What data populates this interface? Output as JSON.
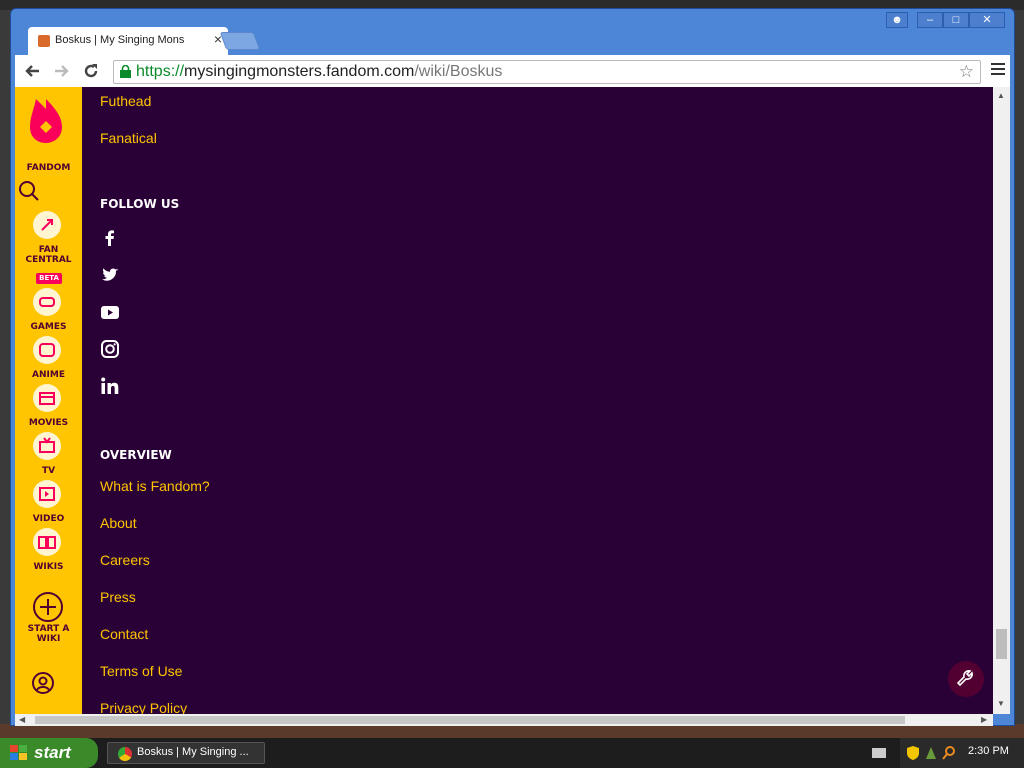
{
  "browser": {
    "tab_title": "Boskus | My Singing Mons",
    "url_scheme": "https://",
    "url_host": "mysingingmonsters.fandom.com",
    "url_path": "/wiki/Boskus",
    "window_buttons": [
      "☻",
      "–",
      "□",
      "✕"
    ]
  },
  "rail": {
    "logo_label": "FANDOM",
    "items": [
      {
        "label1": "FAN",
        "label2": "CENTRAL",
        "badge": "BETA"
      },
      {
        "label1": "GAMES"
      },
      {
        "label1": "ANIME"
      },
      {
        "label1": "MOVIES"
      },
      {
        "label1": "TV"
      },
      {
        "label1": "VIDEO"
      },
      {
        "label1": "WIKIS"
      },
      {
        "label1": "START A",
        "label2": "WIKI"
      }
    ]
  },
  "footer": {
    "top_links": [
      "Futhead",
      "Fanatical"
    ],
    "follow_heading": "FOLLOW US",
    "social": [
      "facebook-icon",
      "twitter-icon",
      "youtube-icon",
      "instagram-icon",
      "linkedin-icon"
    ],
    "overview_heading": "OVERVIEW",
    "overview_links": [
      "What is Fandom?",
      "About",
      "Careers",
      "Press",
      "Contact",
      "Terms of Use",
      "Privacy Policy"
    ]
  },
  "taskbar": {
    "start_label": "start",
    "task_title": "Boskus | My Singing ...",
    "clock": "2:30 PM"
  },
  "colors": {
    "accent": "#ffc500",
    "footer_bg": "#2a0136",
    "brand": "#fa005a"
  }
}
